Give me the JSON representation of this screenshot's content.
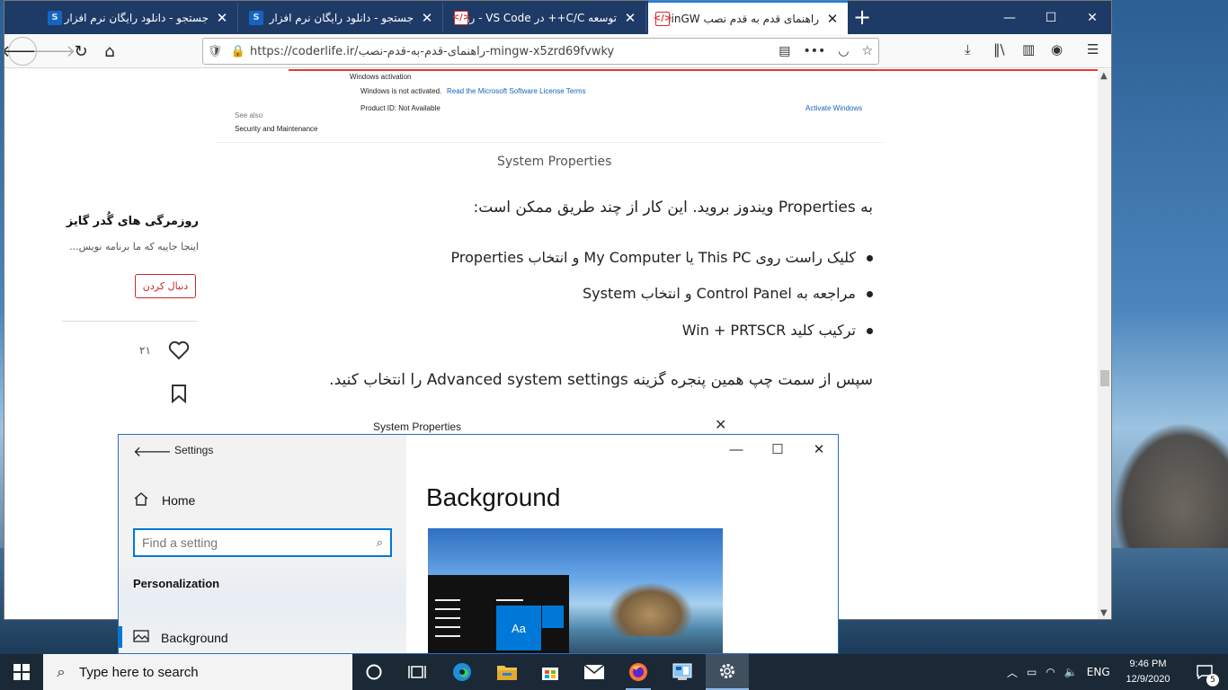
{
  "browser": {
    "tabs": [
      {
        "title": "جستجو - دانلود رایگان نرم افزار",
        "icon": "site-s-icon",
        "active": false
      },
      {
        "title": "جستجو - دانلود رایگان نرم افزار",
        "icon": "site-s-icon",
        "active": false
      },
      {
        "title": "توسعه C/C++ در VS Code - روز",
        "icon": "code-icon",
        "active": false
      },
      {
        "title": "راهنمای قدم به قدم نصب MinGW",
        "icon": "code-icon",
        "active": true
      }
    ],
    "url": "https://coderlife.ir/راهنمای-قدم-به-قدم-نصب-mingw-x5zrd69fvwky",
    "url_domain": "coderlife.ir",
    "accent_color": "#0a84ff",
    "tabbar_color": "#1e3a66"
  },
  "article": {
    "system_image": {
      "windows_activation": "Windows activation",
      "not_activated": "Windows is not activated.",
      "license_link": "Read the Microsoft Software License Terms",
      "product_id": "Product ID: Not Available",
      "activate_link": "Activate Windows",
      "see_also": "See also",
      "security_link": "Security and Maintenance"
    },
    "caption": "System Properties",
    "intro": "به Properties ویندوز بروید. این کار از چند طریق ممکن است:",
    "bullets": [
      "کلیک راست روی This PC یا My Computer و انتخاب Properties",
      "مراجعه به Control Panel و انتخاب System",
      "ترکیب کلید Win + PRTSCR"
    ],
    "then": "سپس از سمت چپ همین پنجره گزینه Advanced system settings را انتخاب کنید.",
    "second_image_title": "System Properties"
  },
  "author": {
    "name": "روزمرگی های گُدر گایز",
    "description": "اینجا جاییه که ما برنامه نویس...",
    "follow_label": "دنبال کردن",
    "like_count": "۲۱"
  },
  "settings": {
    "window_title": "Settings",
    "home_label": "Home",
    "search_placeholder": "Find a setting",
    "section": "Personalization",
    "nav_item": "Background",
    "heading": "Background",
    "preview_tile": "Aa",
    "accent_color": "#0078d7"
  },
  "taskbar": {
    "search_placeholder": "Type here to search",
    "language": "ENG",
    "time": "9:46 PM",
    "date": "12/9/2020",
    "notification_count": "5"
  }
}
